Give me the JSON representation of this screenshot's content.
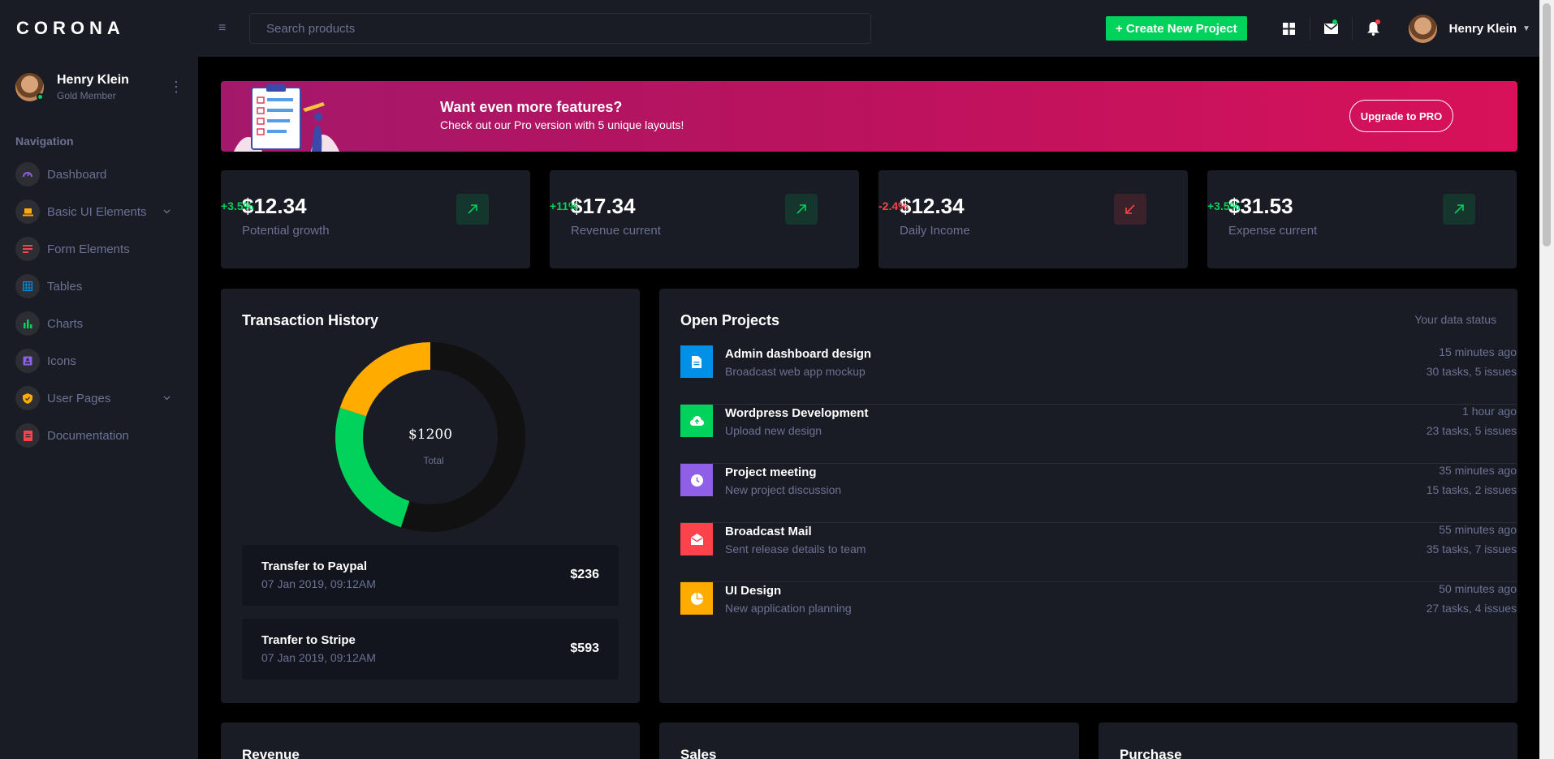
{
  "brand": "CORONA",
  "sidebar": {
    "user": {
      "name": "Henry Klein",
      "role": "Gold Member"
    },
    "nav_heading": "Navigation",
    "items": [
      {
        "label": "Dashboard",
        "icon": "speedometer-icon",
        "color": "#8f5fe8",
        "expandable": false
      },
      {
        "label": "Basic UI Elements",
        "icon": "laptop-icon",
        "color": "#ffab00",
        "expandable": true
      },
      {
        "label": "Form Elements",
        "icon": "playlist-icon",
        "color": "#fc424a",
        "expandable": false
      },
      {
        "label": "Tables",
        "icon": "table-icon",
        "color": "#0090e7",
        "expandable": false
      },
      {
        "label": "Charts",
        "icon": "chart-bar-icon",
        "color": "#00d25b",
        "expandable": false
      },
      {
        "label": "Icons",
        "icon": "contacts-icon",
        "color": "#8f5fe8",
        "expandable": false
      },
      {
        "label": "User Pages",
        "icon": "security-icon",
        "color": "#ffab00",
        "expandable": true
      },
      {
        "label": "Documentation",
        "icon": "file-document-icon",
        "color": "#fc424a",
        "expandable": false
      }
    ]
  },
  "topbar": {
    "search_placeholder": "Search products",
    "create_label": "+ Create New Project",
    "user_name": "Henry Klein"
  },
  "banner": {
    "title": "Want even more features?",
    "subtitle": "Check out our Pro version with 5 unique layouts!",
    "button": "Upgrade to PRO"
  },
  "stats": [
    {
      "value": "$12.34",
      "change": "+3.5%",
      "label": "Potential growth",
      "trend": "up"
    },
    {
      "value": "$17.34",
      "change": "+11%",
      "label": "Revenue current",
      "trend": "up"
    },
    {
      "value": "$12.34",
      "change": "-2.4%",
      "label": "Daily Income",
      "trend": "down"
    },
    {
      "value": "$31.53",
      "change": "+3.5%",
      "label": "Expense current",
      "trend": "up"
    }
  ],
  "transaction_history": {
    "title": "Transaction History",
    "donut_total": "$1200",
    "donut_total_label": "Total",
    "donut_segments": [
      {
        "value": 55,
        "color": "#111111"
      },
      {
        "value": 25,
        "color": "#00d25b"
      },
      {
        "value": 20,
        "color": "#ffab00"
      }
    ],
    "transactions": [
      {
        "title": "Transfer to Paypal",
        "date": "07 Jan 2019, 09:12AM",
        "amount": "$236"
      },
      {
        "title": "Tranfer to Stripe",
        "date": "07 Jan 2019, 09:12AM",
        "amount": "$593"
      }
    ]
  },
  "open_projects": {
    "title": "Open Projects",
    "status_label": "Your data status",
    "projects": [
      {
        "title": "Admin dashboard design",
        "subtitle": "Broadcast web app mockup",
        "time": "15 minutes ago",
        "tasks": "30 tasks, 5 issues",
        "color": "#0090e7",
        "icon": "file-icon"
      },
      {
        "title": "Wordpress Development",
        "subtitle": "Upload new design",
        "time": "1 hour ago",
        "tasks": "23 tasks, 5 issues",
        "color": "#00d25b",
        "icon": "cloud-upload-icon"
      },
      {
        "title": "Project meeting",
        "subtitle": "New project discussion",
        "time": "35 minutes ago",
        "tasks": "15 tasks, 2 issues",
        "color": "#8f5fe8",
        "icon": "clock-icon"
      },
      {
        "title": "Broadcast Mail",
        "subtitle": "Sent release details to team",
        "time": "55 minutes ago",
        "tasks": "35 tasks, 7 issues",
        "color": "#fc424a",
        "icon": "email-open-icon"
      },
      {
        "title": "UI Design",
        "subtitle": "New application planning",
        "time": "50 minutes ago",
        "tasks": "27 tasks, 4 issues",
        "color": "#ffab00",
        "icon": "chart-pie-icon"
      }
    ]
  },
  "bottom_cards": [
    "Revenue",
    "Sales",
    "Purchase"
  ],
  "colors": {
    "green": "#00d25b",
    "red": "#fc424a",
    "card": "#191c24"
  }
}
